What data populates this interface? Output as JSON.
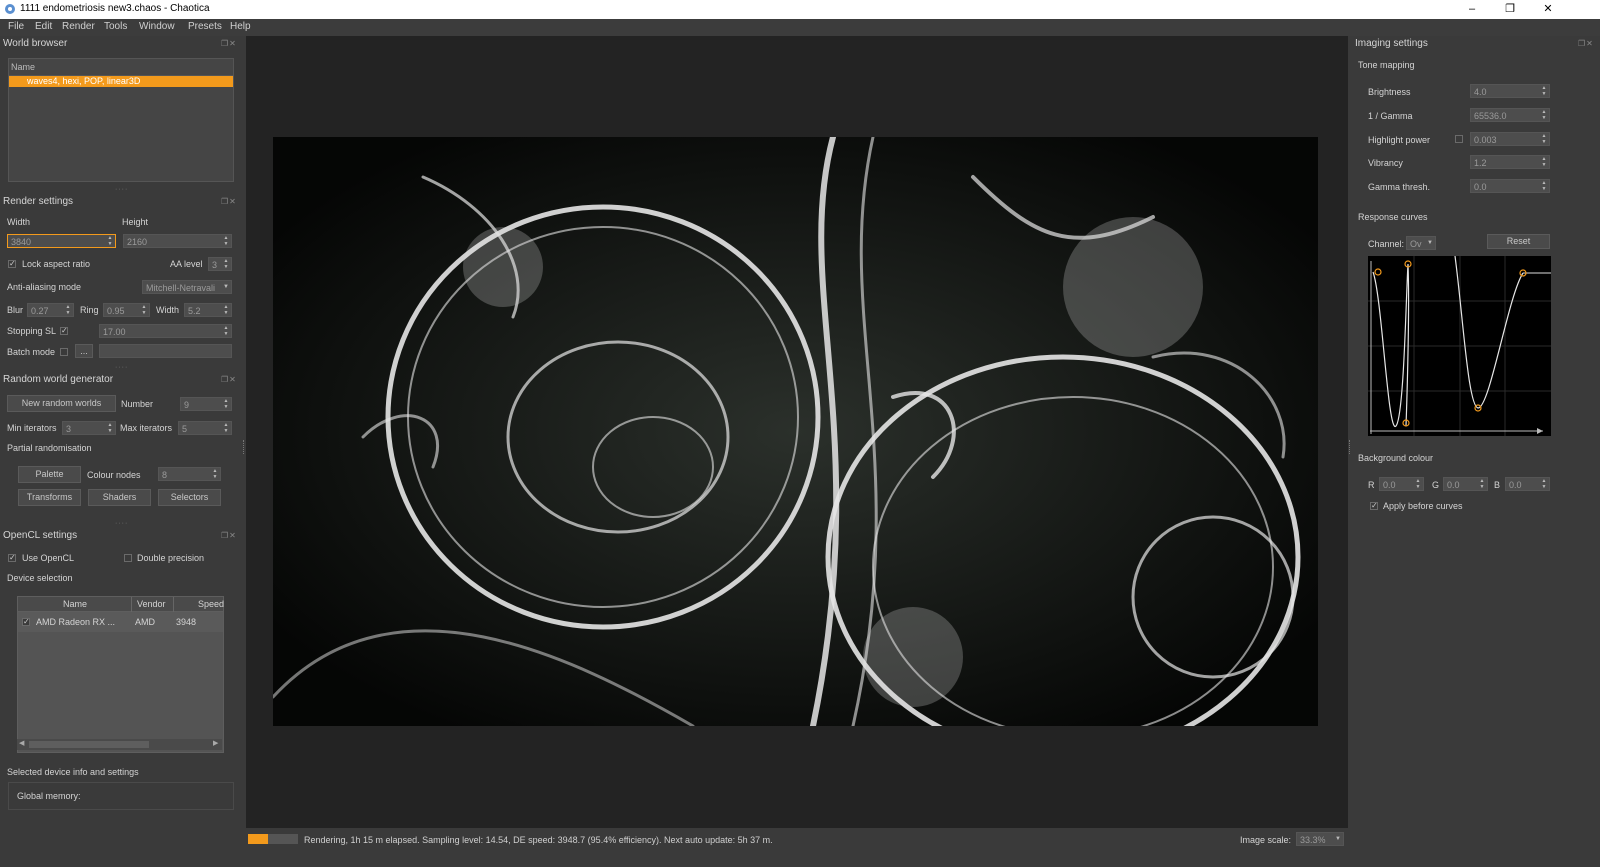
{
  "window": {
    "title": "1111 endometriosis new3.chaos - Chaotica"
  },
  "menu": [
    "File",
    "Edit",
    "Render",
    "Tools",
    "Window",
    "Presets",
    "Help"
  ],
  "world_browser": {
    "title": "World browser",
    "header": "Name",
    "items": [
      "waves4, hexi, POP, linear3D"
    ]
  },
  "render_settings": {
    "title": "Render settings",
    "width_label": "Width",
    "height_label": "Height",
    "width": "3840",
    "height": "2160",
    "lock_aspect_label": "Lock aspect ratio",
    "aa_level_label": "AA level",
    "aa_level": "3",
    "aa_mode_label": "Anti-aliasing mode",
    "aa_mode": "Mitchell-Netravali",
    "blur_label": "Blur",
    "blur": "0.27",
    "ring_label": "Ring",
    "ring": "0.95",
    "filter_width_label": "Width",
    "filter_width": "5.2",
    "stopping_label": "Stopping SL",
    "stopping": "17.00",
    "batch_label": "Batch mode",
    "batch_button": "..."
  },
  "random_gen": {
    "title": "Random world generator",
    "new_button": "New random worlds",
    "number_label": "Number",
    "number": "9",
    "min_label": "Min iterators",
    "min": "3",
    "max_label": "Max iterators",
    "max": "5",
    "partial_label": "Partial randomisation",
    "palette_button": "Palette",
    "colour_nodes_label": "Colour nodes",
    "colour_nodes": "8",
    "transforms_button": "Transforms",
    "shaders_button": "Shaders",
    "selectors_button": "Selectors"
  },
  "opencl": {
    "title": "OpenCL settings",
    "use_label": "Use OpenCL",
    "double_label": "Double precision",
    "device_label": "Device selection",
    "columns": [
      "Name",
      "Vendor",
      "Speed"
    ],
    "devices": [
      {
        "name": "AMD Radeon RX ...",
        "vendor": "AMD",
        "speed": "3948"
      }
    ],
    "selected_info_label": "Selected device info and settings",
    "global_memory_label": "Global memory:"
  },
  "imaging": {
    "title": "Imaging settings",
    "tone_mapping_label": "Tone mapping",
    "brightness_label": "Brightness",
    "brightness": "4.0",
    "gamma_label": "1 / Gamma",
    "gamma": "65536.0",
    "highlight_label": "Highlight power",
    "highlight": "0.003",
    "vibrancy_label": "Vibrancy",
    "vibrancy": "1.2",
    "gamma_thresh_label": "Gamma thresh.",
    "gamma_thresh": "0.0",
    "response_label": "Response curves",
    "channel_label": "Channel:",
    "channel": "Ov",
    "reset_button": "Reset",
    "bg_label": "Background colour",
    "r_label": "R",
    "r": "0.0",
    "g_label": "G",
    "g": "0.0",
    "b_label": "B",
    "b": "0.0",
    "apply_label": "Apply before curves"
  },
  "status": {
    "text": "Rendering, 1h 15 m elapsed. Sampling level: 14.54, DE speed: 3948.7 (95.4% efficiency). Next auto update: 5h 37 m.",
    "progress": 0.4,
    "scale_label": "Image scale:",
    "scale": "33.3%"
  },
  "colors": {
    "accent": "#f39a1c",
    "bg": "#3a3a3a",
    "viewport": "#232323"
  }
}
